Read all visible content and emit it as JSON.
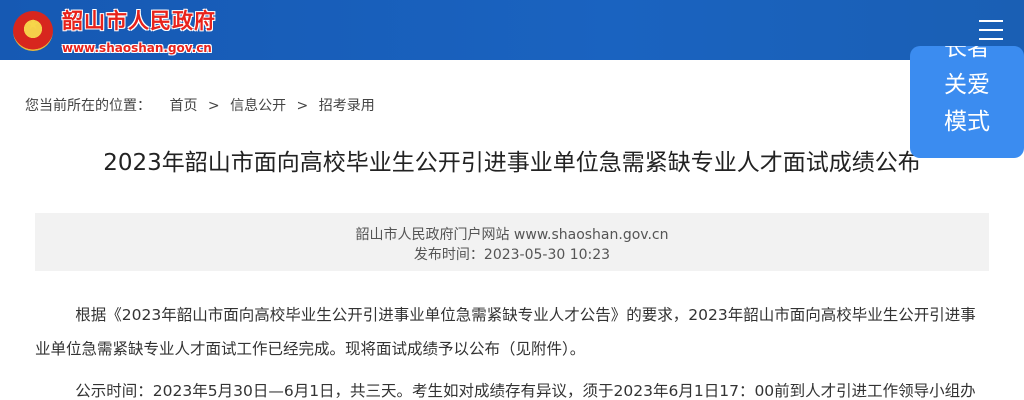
{
  "header": {
    "site_name": "韶山市人民政府",
    "site_domain": "www.shaoshan.gov.cn",
    "emblem_icon": "national-emblem-icon",
    "menu_icon": "hamburger-menu-icon",
    "background_color": "#1a5fb4"
  },
  "care_mode": {
    "lines": [
      "长者",
      "关爱",
      "模式"
    ],
    "background_color": "#3b8cf0"
  },
  "breadcrumb": {
    "label": "您当前所在的位置：",
    "items": [
      "首页",
      "信息公开",
      "招考录用"
    ],
    "separator": ">"
  },
  "article": {
    "title": "2023年韶山市面向高校毕业生公开引进事业单位急需紧缺专业人才面试成绩公布",
    "source": "韶山市人民政府门户网站 www.shaoshan.gov.cn",
    "publish_label": "发布时间：",
    "publish_time": "2023-05-30 10:23",
    "paragraphs": [
      "根据《2023年韶山市面向高校毕业生公开引进事业单位急需紧缺专业人才公告》的要求，2023年韶山市面向高校毕业生公开引进事业单位急需紧缺专业人才面试工作已经完成。现将面试成绩予以公布（见附件）。",
      "公示时间：2023年5月30日—6月1日，共三天。考生如对成绩存有异议，须于2023年6月1日17：00前到人才引进工作领导小组办"
    ]
  }
}
